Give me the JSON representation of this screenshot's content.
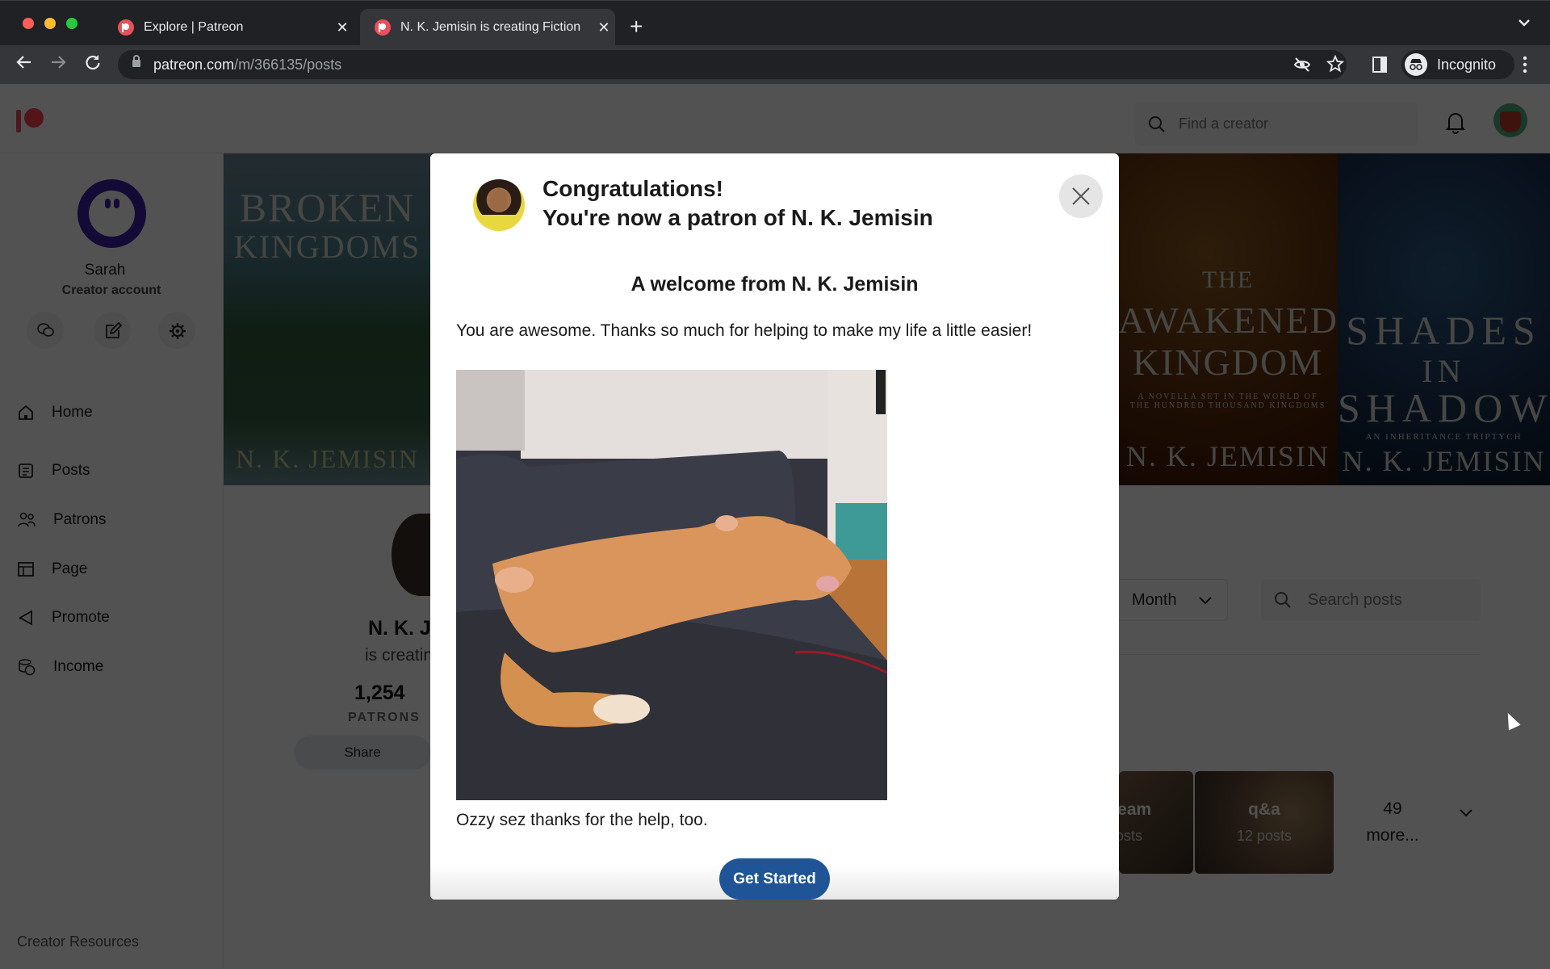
{
  "browser": {
    "tabs": [
      {
        "title": "Explore | Patreon",
        "active": false
      },
      {
        "title": "N. K. Jemisin is creating Fiction",
        "active": true
      }
    ],
    "url_host": "patreon.com",
    "url_path": "/m/366135/posts",
    "profile_label": "Incognito"
  },
  "topnav": {
    "search_placeholder": "Find a creator"
  },
  "sidebar": {
    "user_name": "Sarah",
    "account_type": "Creator account",
    "items": [
      {
        "label": "Home",
        "icon": "home-icon"
      },
      {
        "label": "Posts",
        "icon": "posts-icon"
      },
      {
        "label": "Patrons",
        "icon": "patrons-icon"
      },
      {
        "label": "Page",
        "icon": "page-icon"
      },
      {
        "label": "Promote",
        "icon": "promote-icon"
      },
      {
        "label": "Income",
        "icon": "income-icon"
      }
    ],
    "footer_link": "Creator Resources"
  },
  "hero": {
    "covers": [
      {
        "title_lines": [
          "BROKEN",
          "KINGDOMS"
        ],
        "author": "N. K. JEMISIN"
      },
      {
        "title_lines": [
          "THE",
          "AWAKENED",
          "KINGDOM"
        ],
        "subtitle": "A NOVELLA SET IN THE WORLD OF THE HUNDRED THOUSAND KINGDOMS",
        "author": "N. K. JEMISIN"
      },
      {
        "title_lines": [
          "SHADES",
          "IN",
          "SHADOW"
        ],
        "subtitle": "AN INHERITANCE TRIPTYCH",
        "author": "N. K. JEMISIN"
      }
    ]
  },
  "profile": {
    "name_partial": "N. K. J",
    "tagline_partial": "is creatin",
    "patron_count": "1,254",
    "patron_label": "PATRONS",
    "share_label": "Share"
  },
  "posts": {
    "filter_month": "Month",
    "search_placeholder": "Search posts",
    "tags": [
      {
        "name": "ream",
        "count": "osts"
      },
      {
        "name": "q&a",
        "count": "12 posts"
      }
    ],
    "more_count": "49",
    "more_label": "more..."
  },
  "modal": {
    "title_line1": "Congratulations!",
    "title_line2": "You're now a patron of N. K. Jemisin",
    "welcome_heading": "A welcome from N. K. Jemisin",
    "welcome_body": "You are awesome. Thanks so much for helping to make my life a little easier!",
    "image_caption": "Ozzy sez thanks for the help, too.",
    "cta_label": "Get Started"
  },
  "colors": {
    "patreon_brand": "#ff424d",
    "cta_blue": "#1f5597"
  }
}
